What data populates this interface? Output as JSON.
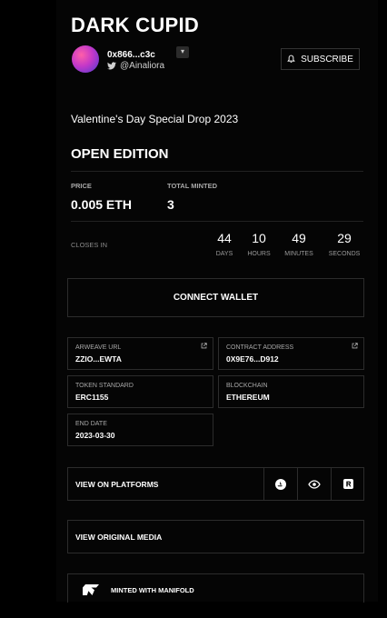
{
  "header": {
    "title": "DARK CUPID",
    "creator_address": "0x866...c3c",
    "twitter_handle": "@Ainaliora",
    "menu_glyph": "▾",
    "subscribe_label": "SUBSCRIBE"
  },
  "drop": {
    "name": "Valentine's Day Special Drop 2023",
    "edition": "OPEN EDITION"
  },
  "sale": {
    "price_label": "PRICE",
    "price_value": "0.005 ETH",
    "minted_label": "TOTAL MINTED",
    "minted_value": "3"
  },
  "countdown": {
    "label": "CLOSES IN",
    "units": [
      {
        "value": "44",
        "label": "DAYS"
      },
      {
        "value": "10",
        "label": "HOURS"
      },
      {
        "value": "49",
        "label": "MINUTES"
      },
      {
        "value": "29",
        "label": "SECONDS"
      }
    ]
  },
  "connect_label": "CONNECT WALLET",
  "details": {
    "arweave": {
      "label": "ARWEAVE URL",
      "value": "ZZIO...EWTA"
    },
    "contract": {
      "label": "CONTRACT ADDRESS",
      "value": "0X9E76...D912"
    },
    "token_standard": {
      "label": "TOKEN STANDARD",
      "value": "ERC1155"
    },
    "blockchain": {
      "label": "BLOCKCHAIN",
      "value": "ETHEREUM"
    },
    "end_date": {
      "label": "END DATE",
      "value": "2023-03-30"
    }
  },
  "platforms_label": "VIEW ON PLATFORMS",
  "platform_icons": [
    "opensea-icon",
    "rarible-eye-icon",
    "r-logo-icon"
  ],
  "original_media_label": "VIEW ORIGINAL MEDIA",
  "manifold_label": "MINTED WITH MANIFOLD",
  "colors": {
    "background": "#000000",
    "border": "#2c2c2c",
    "muted": "#a8a8a8",
    "text": "#ffffff"
  }
}
